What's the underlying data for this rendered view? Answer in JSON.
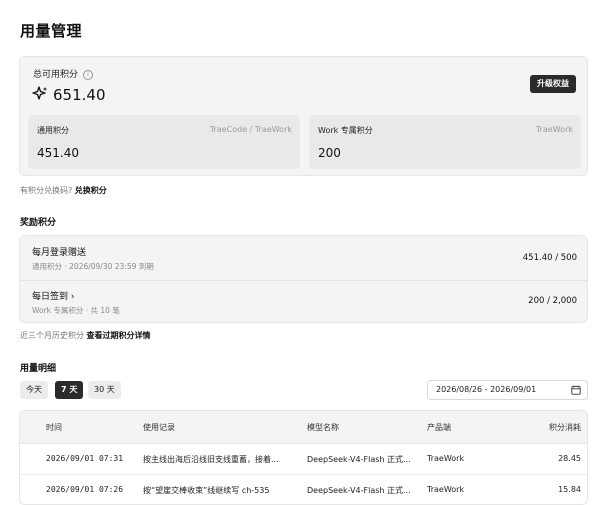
{
  "page": {
    "title": "用量管理"
  },
  "summary": {
    "total_label": "总可用积分",
    "total_value": "651.40",
    "upgrade_label": "升级权益",
    "general": {
      "label": "通用积分",
      "tag": "TraeCode / TraeWork",
      "value": "451.40"
    },
    "work": {
      "label": "Work 专属积分",
      "tag": "TraeWork",
      "value": "200"
    }
  },
  "redeem": {
    "question": "有积分兑换码?",
    "link": "兑换积分"
  },
  "rewards": {
    "section_title": "奖励积分",
    "items": [
      {
        "title": "每月登录赠送",
        "sub": "通用积分 · 2026/09/30 23:59 到期",
        "value": "451.40 / 500"
      },
      {
        "title": "每日签到",
        "chevron": "›",
        "sub": "Work 专属积分 · 共 10 笔",
        "value": "200 / 2,000"
      }
    ]
  },
  "history": {
    "text": "近三个月历史积分",
    "link": "查看过期积分详情"
  },
  "usage": {
    "section_title": "用量明细",
    "ranges": [
      "今天",
      "7 天",
      "30 天"
    ],
    "active_range": "7 天",
    "date_range": "2026/08/26 - 2026/09/01",
    "columns": [
      "时间",
      "使用记录",
      "模型名称",
      "产品端",
      "积分消耗"
    ],
    "rows": [
      {
        "time": "2026/09/01 07:31",
        "record": "按主线出海后沿线旧支线重蓄，接着...",
        "model": "DeepSeek-V4-Flash 正式...",
        "product": "TraeWork",
        "cost": "28.45"
      },
      {
        "time": "2026/09/01 07:26",
        "record": "按“望崖交棒收束”线继续写 ch-535",
        "model": "DeepSeek-V4-Flash 正式...",
        "product": "TraeWork",
        "cost": "15.84"
      }
    ]
  }
}
